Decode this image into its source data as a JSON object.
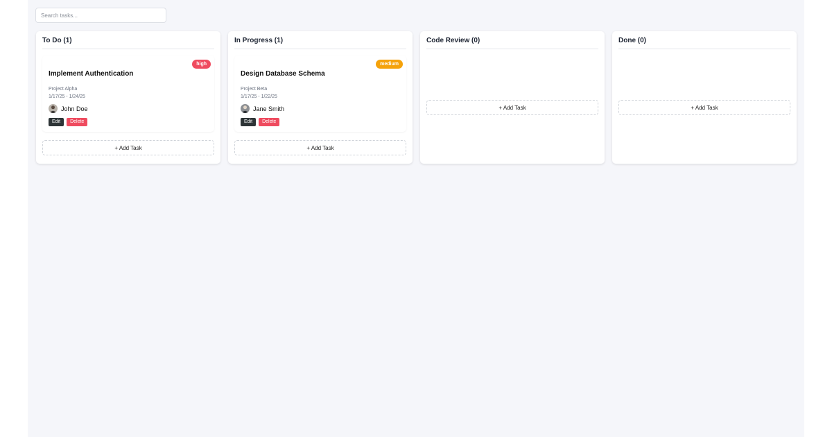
{
  "search": {
    "placeholder": "Search tasks..."
  },
  "colors": {
    "high": "#ef4b5f",
    "medium": "#f5a20a",
    "edit": "#2d3436",
    "delete": "#ef4b5f"
  },
  "columns": [
    {
      "title": "To Do (1)",
      "add_label": "+ Add Task",
      "card": {
        "priority": "high",
        "title": "Implement Authentication",
        "project": "Project Alpha",
        "dates": "1/17/25 - 1/24/25",
        "assignee": "John Doe",
        "avatar_icon": "person-avatar-icon",
        "edit_label": "Edit",
        "delete_label": "Delete"
      }
    },
    {
      "title": "In Progress (1)",
      "add_label": "+ Add Task",
      "card": {
        "priority": "medium",
        "title": "Design Database Schema",
        "project": "Project Beta",
        "dates": "1/17/25 - 1/22/25",
        "assignee": "Jane Smith",
        "avatar_icon": "person-avatar-icon",
        "edit_label": "Edit",
        "delete_label": "Delete"
      }
    },
    {
      "title": "Code Review (0)",
      "add_label": "+ Add Task"
    },
    {
      "title": "Done (0)",
      "add_label": "+ Add Task"
    }
  ]
}
